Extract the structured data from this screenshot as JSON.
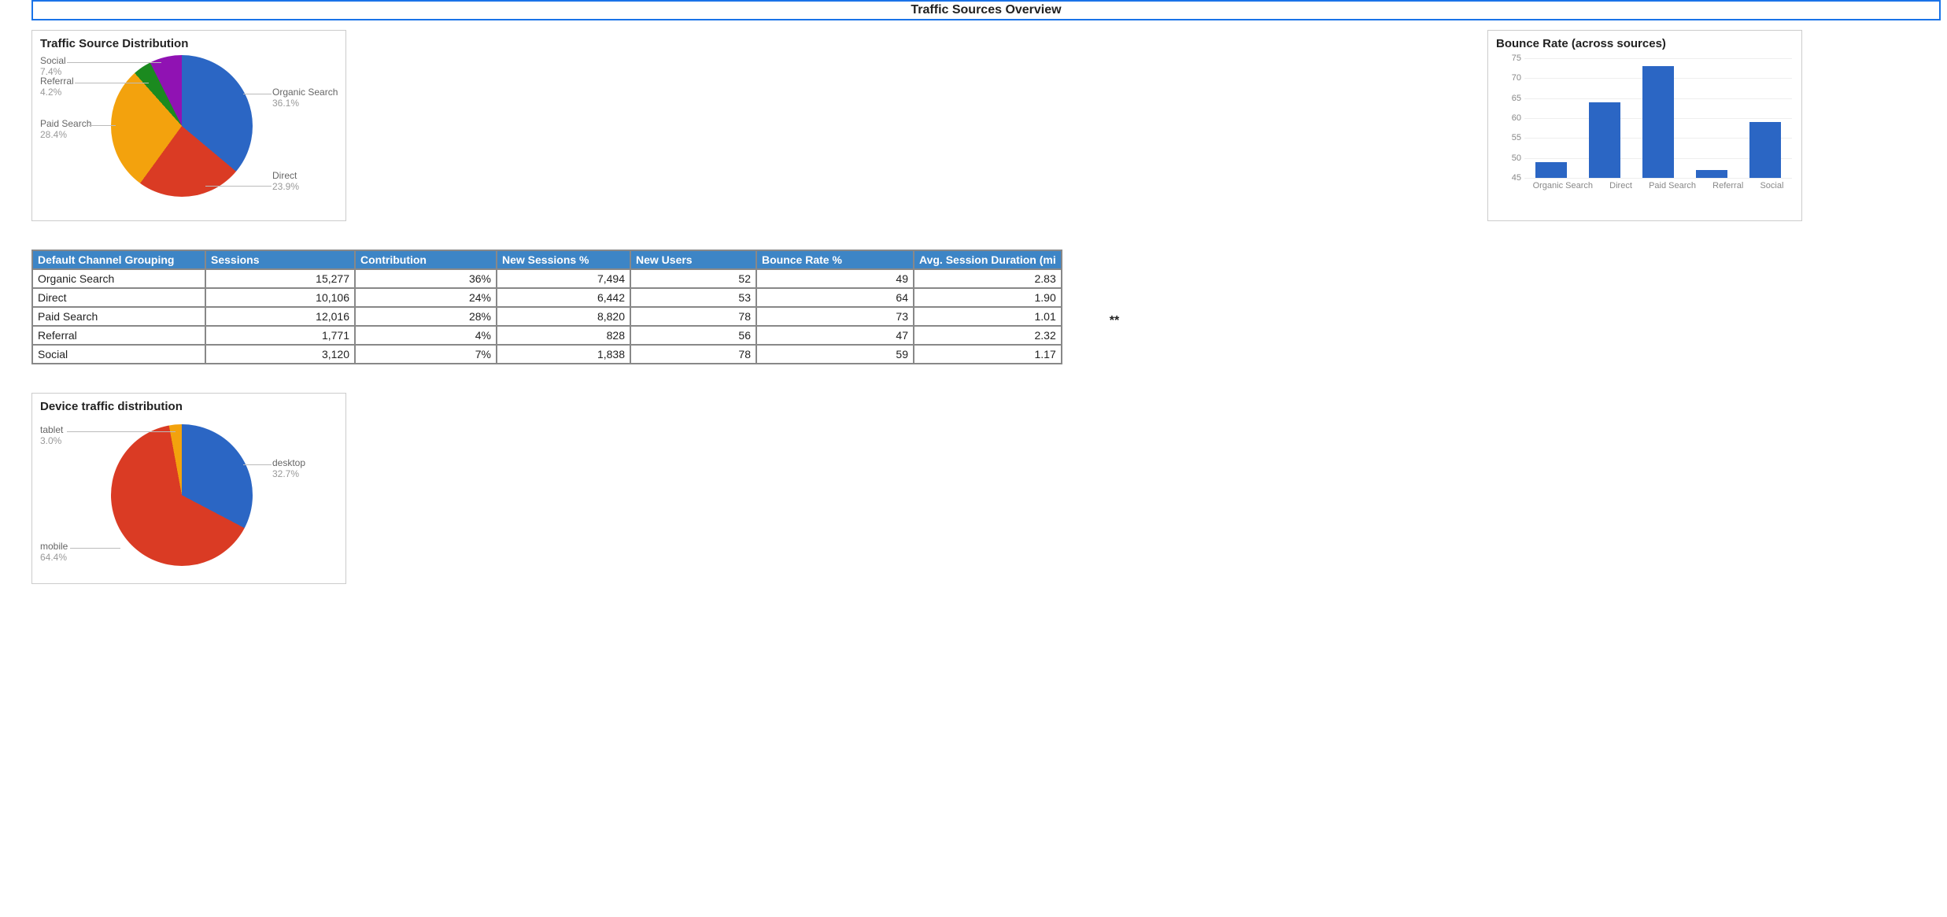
{
  "header": {
    "title": "Traffic Sources Overview"
  },
  "pie_sources": {
    "title": "Traffic Source Distribution",
    "labels": {
      "organic_name": "Organic Search",
      "organic_pct": "36.1%",
      "direct_name": "Direct",
      "direct_pct": "23.9%",
      "paid_name": "Paid Search",
      "paid_pct": "28.4%",
      "referral_name": "Referral",
      "referral_pct": "4.2%",
      "social_name": "Social",
      "social_pct": "7.4%"
    }
  },
  "bar_bounce": {
    "title": "Bounce Rate (across sources)",
    "ticks": {
      "t45": "45",
      "t50": "50",
      "t55": "55",
      "t60": "60",
      "t65": "65",
      "t70": "70",
      "t75": "75"
    },
    "xlabels": {
      "x0": "Organic Search",
      "x1": "Direct",
      "x2": "Paid Search",
      "x3": "Referral",
      "x4": "Social"
    }
  },
  "table": {
    "headers": {
      "h0": "Default Channel Grouping",
      "h1": "Sessions",
      "h2": "Contribution",
      "h3": "New Sessions %",
      "h4": "New Users",
      "h5": "Bounce Rate %",
      "h6": "Avg. Session Duration (mi"
    },
    "rows": [
      {
        "c0": "Organic Search",
        "c1": "15,277",
        "c2": "36%",
        "c3": "7,494",
        "c4": "52",
        "c5": "49",
        "c6": "2.83"
      },
      {
        "c0": "Direct",
        "c1": "10,106",
        "c2": "24%",
        "c3": "6,442",
        "c4": "53",
        "c5": "64",
        "c6": "1.90"
      },
      {
        "c0": "Paid Search",
        "c1": "12,016",
        "c2": "28%",
        "c3": "8,820",
        "c4": "78",
        "c5": "73",
        "c6": "1.01"
      },
      {
        "c0": "Referral",
        "c1": "1,771",
        "c2": "4%",
        "c3": "828",
        "c4": "56",
        "c5": "47",
        "c6": "2.32"
      },
      {
        "c0": "Social",
        "c1": "3,120",
        "c2": "7%",
        "c3": "1,838",
        "c4": "78",
        "c5": "59",
        "c6": "1.17"
      }
    ]
  },
  "pie_device": {
    "title": "Device traffic distribution",
    "labels": {
      "desktop_name": "desktop",
      "desktop_pct": "32.7%",
      "mobile_name": "mobile",
      "mobile_pct": "64.4%",
      "tablet_name": "tablet",
      "tablet_pct": "3.0%"
    }
  },
  "extra_asterisks": "**",
  "chart_data": [
    {
      "type": "pie",
      "title": "Traffic Source Distribution",
      "series": [
        {
          "name": "Organic Search",
          "value": 36.1,
          "color": "#2b66c4"
        },
        {
          "name": "Direct",
          "value": 23.9,
          "color": "#da3b24"
        },
        {
          "name": "Paid Search",
          "value": 28.4,
          "color": "#f3a20d"
        },
        {
          "name": "Referral",
          "value": 4.2,
          "color": "#1b8a1f"
        },
        {
          "name": "Social",
          "value": 7.4,
          "color": "#9012b3"
        }
      ]
    },
    {
      "type": "bar",
      "title": "Bounce Rate (across sources)",
      "categories": [
        "Organic Search",
        "Direct",
        "Paid Search",
        "Referral",
        "Social"
      ],
      "values": [
        49,
        64,
        73,
        47,
        59
      ],
      "ylim": [
        45,
        75
      ],
      "ylabel": "",
      "xlabel": ""
    },
    {
      "type": "pie",
      "title": "Device traffic distribution",
      "series": [
        {
          "name": "desktop",
          "value": 32.7,
          "color": "#2b66c4"
        },
        {
          "name": "mobile",
          "value": 64.4,
          "color": "#da3b24"
        },
        {
          "name": "tablet",
          "value": 3.0,
          "color": "#f3a20d"
        }
      ]
    },
    {
      "type": "table",
      "title": "Traffic Sources Table",
      "columns": [
        "Default Channel Grouping",
        "Sessions",
        "Contribution",
        "New Sessions %",
        "New Users",
        "Bounce Rate %",
        "Avg. Session Duration (min)"
      ],
      "rows": [
        [
          "Organic Search",
          15277,
          "36%",
          7494,
          52,
          49,
          2.83
        ],
        [
          "Direct",
          10106,
          "24%",
          6442,
          53,
          64,
          1.9
        ],
        [
          "Paid Search",
          12016,
          "28%",
          8820,
          78,
          73,
          1.01
        ],
        [
          "Referral",
          1771,
          "4%",
          828,
          56,
          47,
          2.32
        ],
        [
          "Social",
          3120,
          "7%",
          1838,
          78,
          59,
          1.17
        ]
      ]
    }
  ]
}
